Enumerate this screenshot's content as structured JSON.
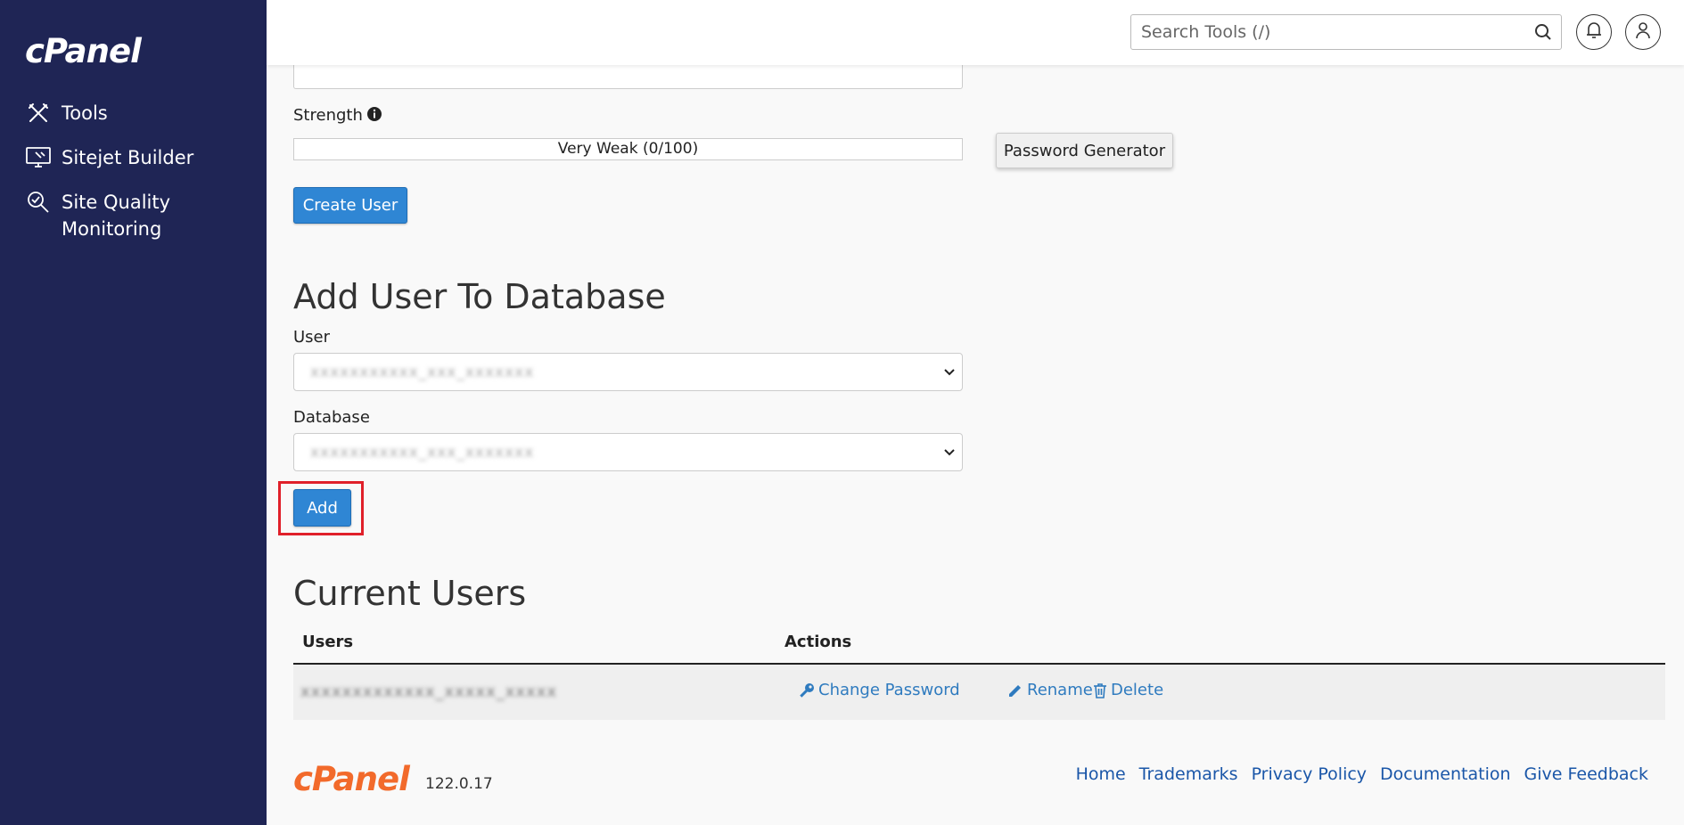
{
  "sidebar": {
    "logo": "cPanel",
    "items": [
      {
        "label": "Tools",
        "icon": "tools-icon"
      },
      {
        "label": "Sitejet Builder",
        "icon": "sitejet-icon"
      },
      {
        "label": "Site Quality Monitoring",
        "icon": "site-quality-icon"
      }
    ]
  },
  "header": {
    "search_placeholder": "Search Tools (/)"
  },
  "create_user": {
    "strength_label": "Strength",
    "strength_value": "Very Weak (0/100)",
    "password_generator_label": "Password Generator",
    "create_button_label": "Create User"
  },
  "add_user_to_db": {
    "title": "Add User To Database",
    "user_label": "User",
    "user_value": "xxxxxxxxxxx_xxx_xxxxxxx",
    "database_label": "Database",
    "database_value": "xxxxxxxxxxx_xxx_xxxxxxx",
    "add_button_label": "Add"
  },
  "current_users": {
    "title": "Current Users",
    "columns": [
      "Users",
      "Actions"
    ],
    "rows": [
      {
        "user": "xxxxxxxxxxxxx_xxxxx_xxxxx"
      }
    ],
    "actions": {
      "change_password": "Change Password",
      "rename": "Rename",
      "delete": "Delete"
    }
  },
  "footer": {
    "logo": "cPanel",
    "version": "122.0.17",
    "links": [
      "Home",
      "Trademarks",
      "Privacy Policy",
      "Documentation",
      "Give Feedback"
    ]
  },
  "colors": {
    "sidebar_bg": "#1f2555",
    "primary_button": "#2f86d4",
    "highlight": "#e0202a",
    "footer_logo": "#f26a2b",
    "link": "#2f7bbf"
  }
}
